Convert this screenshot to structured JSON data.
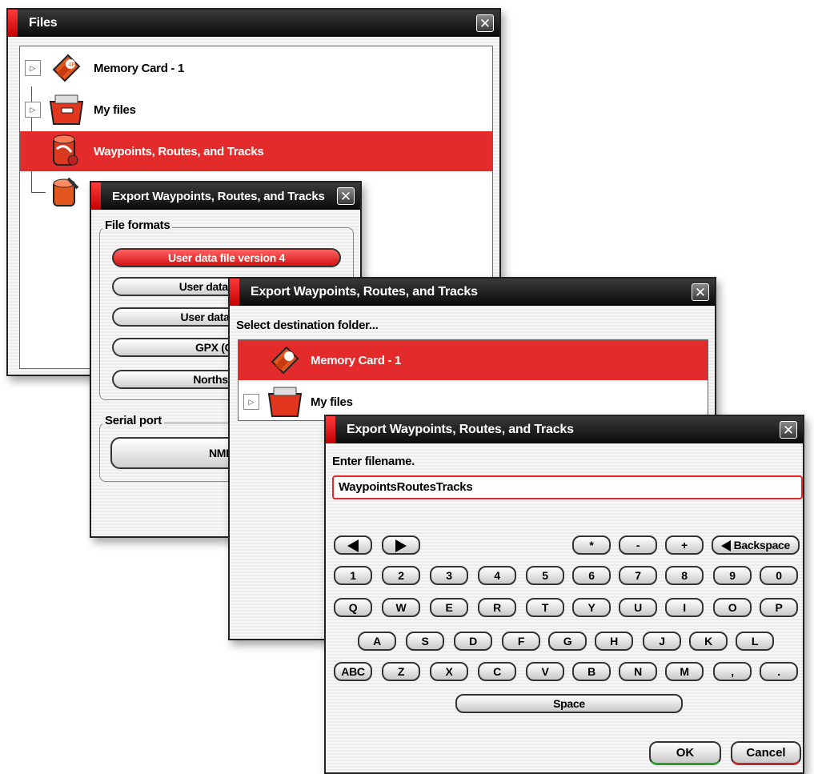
{
  "files_window": {
    "title": "Files",
    "close_label": "✕",
    "tree": [
      {
        "label": "Memory Card - 1",
        "icon": "memory-card-icon"
      },
      {
        "label": "My files",
        "icon": "folder-icon"
      },
      {
        "label": "Waypoints, Routes, and Tracks",
        "icon": "waypoints-database-icon",
        "selected": true
      },
      {
        "label": "",
        "icon": "database-settings-icon"
      }
    ]
  },
  "format_window": {
    "title": "Export Waypoints, Routes, and Tracks",
    "close_label": "✕",
    "file_formats_label": "File formats",
    "formats": [
      "User data file version 4",
      "User data file versi",
      "User data file vers",
      "GPX (GPS E",
      "Northstar .da"
    ],
    "serial_port_label": "Serial port",
    "serial_button": "NMEA"
  },
  "dest_window": {
    "title": "Export Waypoints, Routes, and Tracks",
    "close_label": "✕",
    "prompt": "Select destination folder...",
    "tree": [
      {
        "label": "Memory Card - 1",
        "icon": "memory-card-icon",
        "selected": true
      },
      {
        "label": "My files",
        "icon": "folder-icon"
      }
    ]
  },
  "filename_window": {
    "title": "Export Waypoints, Routes, and Tracks",
    "close_label": "✕",
    "prompt": "Enter filename.",
    "filename_value": "WaypointsRoutesTracks",
    "keys_row1": [
      "*",
      "-",
      "+"
    ],
    "backspace_label": "Backspace",
    "digits": [
      "1",
      "2",
      "3",
      "4",
      "5",
      "6",
      "7",
      "8",
      "9",
      "0"
    ],
    "row_q": [
      "Q",
      "W",
      "E",
      "R",
      "T",
      "Y",
      "U",
      "I",
      "O",
      "P"
    ],
    "row_a": [
      "A",
      "S",
      "D",
      "F",
      "G",
      "H",
      "J",
      "K",
      "L"
    ],
    "abc_label": "ABC",
    "row_z": [
      "Z",
      "X",
      "C",
      "V",
      "B",
      "N",
      "M",
      ",",
      "."
    ],
    "space_label": "Space",
    "ok_label": "OK",
    "cancel_label": "Cancel"
  },
  "colors": {
    "accent_red": "#e42b2b",
    "titlebar_black": "#0a0a0a"
  }
}
